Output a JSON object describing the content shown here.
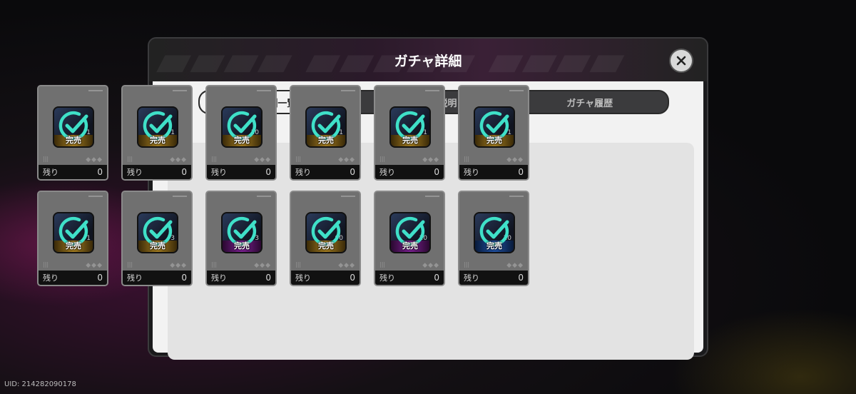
{
  "dialog": {
    "title": "ガチャ詳細",
    "close_icon": "close-icon"
  },
  "tabs": [
    {
      "label": "報酬一覧",
      "active": true
    },
    {
      "label": "ルール説明",
      "active": false
    },
    {
      "label": "ガチャ履歴",
      "active": false
    }
  ],
  "rewards": [
    {
      "count": "1",
      "status": "完売",
      "remain_label": "残り",
      "remain": "0",
      "rarity": "gold"
    },
    {
      "count": "1",
      "status": "完売",
      "remain_label": "残り",
      "remain": "0",
      "rarity": "gold"
    },
    {
      "count": "10",
      "status": "完売",
      "remain_label": "残り",
      "remain": "0",
      "rarity": "gold"
    },
    {
      "count": "1",
      "status": "完売",
      "remain_label": "残り",
      "remain": "0",
      "rarity": "gold"
    },
    {
      "count": "1",
      "status": "完売",
      "remain_label": "残り",
      "remain": "0",
      "rarity": "gold"
    },
    {
      "count": "1",
      "status": "完売",
      "remain_label": "残り",
      "remain": "0",
      "rarity": "gold"
    },
    {
      "count": "1",
      "status": "完売",
      "remain_label": "残り",
      "remain": "0",
      "rarity": "gold"
    },
    {
      "count": "3",
      "status": "完売",
      "remain_label": "残り",
      "remain": "0",
      "rarity": "gold"
    },
    {
      "count": "3",
      "status": "完売",
      "remain_label": "残り",
      "remain": "0",
      "rarity": "purple"
    },
    {
      "count": "00",
      "status": "完売",
      "remain_label": "残り",
      "remain": "0",
      "rarity": "gold"
    },
    {
      "count": "10",
      "status": "完売",
      "remain_label": "残り",
      "remain": "0",
      "rarity": "purple"
    },
    {
      "count": "10",
      "status": "完売",
      "remain_label": "残り",
      "remain": "0",
      "rarity": "blue"
    }
  ],
  "footer": {
    "uid": "UID: 214282090178"
  },
  "colors": {
    "check": "#3fe0c8",
    "card": "#707070"
  }
}
